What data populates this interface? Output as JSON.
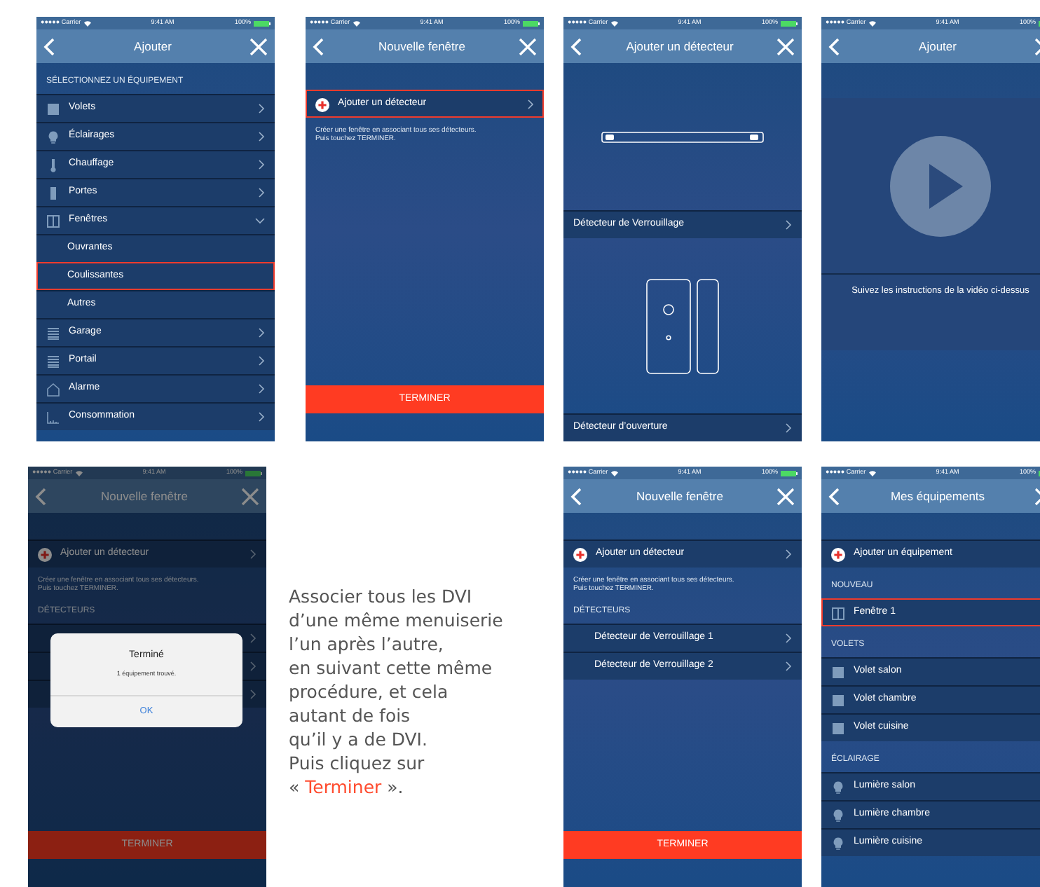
{
  "panels": [
    {
      "kind": "phone",
      "status": {
        "carrier": "●●●●● Carrier",
        "time": "9:41 AM",
        "battery": "100%"
      },
      "title": "Ajouter",
      "dimmed": false,
      "blocks": [
        {
          "kind": "section",
          "label": "SÉLECTIONNEZ UN ÉQUIPEMENT"
        },
        {
          "kind": "shutter",
          "label": "Volets",
          "expanded": false,
          "sub": false,
          "highlighted": false
        },
        {
          "kind": "bulb",
          "label": "Éclairages",
          "expanded": false,
          "sub": false,
          "highlighted": false
        },
        {
          "kind": "thermometer",
          "label": "Chauffage",
          "expanded": false,
          "sub": false,
          "highlighted": false
        },
        {
          "kind": "door",
          "label": "Portes",
          "expanded": false,
          "sub": false,
          "highlighted": false
        },
        {
          "kind": "window",
          "label": "Fenêtres",
          "expanded": true,
          "sub": false,
          "highlighted": false
        },
        {
          "kind": "plain",
          "label": "Ouvrantes",
          "sub": true,
          "highlighted": false
        },
        {
          "kind": "plain",
          "label": "Coulissantes",
          "sub": true,
          "highlighted": true
        },
        {
          "kind": "plain",
          "label": "Autres",
          "sub": true,
          "highlighted": false
        },
        {
          "kind": "lines",
          "label": "Garage",
          "expanded": false,
          "sub": false,
          "highlighted": false
        },
        {
          "kind": "lines",
          "label": "Portail",
          "expanded": false,
          "sub": false,
          "highlighted": false
        },
        {
          "kind": "house",
          "label": "Alarme",
          "expanded": false,
          "sub": false,
          "highlighted": false
        },
        {
          "kind": "chart",
          "label": "Consommation",
          "expanded": false,
          "sub": false,
          "highlighted": false
        }
      ]
    },
    {
      "kind": "phone",
      "status": {
        "carrier": "●●●●● Carrier",
        "time": "9:41 AM",
        "battery": "100%"
      },
      "title": "Nouvelle fenêtre",
      "dimmed": false,
      "blocks": [
        {
          "kind": "add",
          "label": "Ajouter un détecteur",
          "expanded": false,
          "sub": false,
          "highlighted": true
        },
        {
          "kind": "note",
          "text": "Créer une fenêtre en associant tous ses détecteurs.\nPuis touchez TERMINER."
        }
      ],
      "button": "TERMINER"
    },
    {
      "kind": "phone",
      "status": {
        "carrier": "●●●●● Carrier",
        "time": "9:41 AM",
        "battery": "100%"
      },
      "title": "Ajouter un détecteur",
      "dimmed": false,
      "blocks": [
        {
          "kind": "bar-sensor"
        },
        {
          "kind": "plain",
          "label": "Détecteur de Verrouillage",
          "expanded": false,
          "sub": false,
          "highlighted": false
        },
        {
          "kind": "door-sensor"
        },
        {
          "kind": "plain",
          "label": "Détecteur d’ouverture",
          "expanded": false,
          "sub": false,
          "highlighted": false
        }
      ]
    },
    {
      "kind": "phone",
      "status": {
        "carrier": "●●●●● Carrier",
        "time": "9:41 AM",
        "battery": "100%"
      },
      "title": "Ajouter",
      "dimmed": false,
      "blocks": [
        {
          "kind": "video",
          "caption": "Suivez les instructions de la vidéo ci-dessus"
        }
      ]
    },
    {
      "kind": "phone",
      "status": {
        "carrier": "●●●●● Carrier",
        "time": "9:41 AM",
        "battery": "100%"
      },
      "title": "Nouvelle fenêtre",
      "dimmed": true,
      "blocks": [
        {
          "kind": "add",
          "label": "Ajouter un détecteur",
          "expanded": false,
          "sub": false,
          "highlighted": false
        },
        {
          "kind": "note",
          "text": "Créer une fenêtre en associant tous ses détecteurs.\nPuis touchez TERMINER."
        },
        {
          "kind": "section",
          "label": "DÉTECTEURS"
        },
        {
          "kind": "plain",
          "expanded": false,
          "highlighted": false
        },
        {
          "kind": "plain",
          "expanded": false,
          "highlighted": false
        },
        {
          "kind": "plain",
          "expanded": false,
          "highlighted": false
        }
      ],
      "button": "TERMINER",
      "dialog": {
        "title": "Terminé",
        "message": "1 équipement trouvé.",
        "action": "OK"
      }
    },
    {
      "kind": "text",
      "lines": [
        "Associer tous les DVI",
        "d’une même menuiserie",
        "l’un après l’autre,",
        "en suivant cette même",
        "procédure, et cela",
        "autant de fois",
        "qu’il y a de DVI.",
        "Puis cliquez sur"
      ],
      "last_line": {
        "before": "« ",
        "highlight": "Terminer",
        "after": " »."
      }
    },
    {
      "kind": "phone",
      "status": {
        "carrier": "●●●●● Carrier",
        "time": "9:41 AM",
        "battery": "100%"
      },
      "title": "Nouvelle fenêtre",
      "dimmed": false,
      "blocks": [
        {
          "kind": "add",
          "label": "Ajouter un détecteur",
          "expanded": false,
          "sub": false,
          "highlighted": false
        },
        {
          "kind": "note",
          "text": "Créer une fenêtre en associant tous ses détecteurs.\nPuis touchez TERMINER."
        },
        {
          "kind": "section",
          "label": "DÉTECTEURS"
        },
        {
          "kind": "plain",
          "label": "Détecteur de Verrouillage 1",
          "expanded": false,
          "sub": true,
          "highlighted": false
        },
        {
          "kind": "plain",
          "label": "Détecteur de Verrouillage 2",
          "expanded": false,
          "sub": true,
          "highlighted": false
        }
      ],
      "button": "TERMINER"
    },
    {
      "kind": "phone",
      "status": {
        "carrier": "●●●●● Carrier",
        "time": "9:41 AM",
        "battery": "100%"
      },
      "title": "Mes équipements",
      "dimmed": false,
      "blocks": [
        {
          "kind": "add",
          "label": "Ajouter un équipement",
          "sub": false,
          "highlighted": false
        },
        {
          "kind": "section",
          "label": "NOUVEAU"
        },
        {
          "kind": "window",
          "label": "Fenêtre 1",
          "sub": false,
          "highlighted": true
        },
        {
          "kind": "section",
          "label": "VOLETS"
        },
        {
          "kind": "shutter",
          "label": "Volet salon",
          "sub": false,
          "highlighted": false
        },
        {
          "kind": "shutter",
          "label": "Volet chambre",
          "sub": false,
          "highlighted": false
        },
        {
          "kind": "shutter",
          "label": "Volet cuisine",
          "sub": false,
          "highlighted": false
        },
        {
          "kind": "section",
          "label": "ÉCLAIRAGE"
        },
        {
          "kind": "bulb",
          "label": "Lumière salon",
          "sub": false,
          "highlighted": false
        },
        {
          "kind": "bulb",
          "label": "Lumière chambre",
          "sub": false,
          "highlighted": false
        },
        {
          "kind": "bulb",
          "label": "Lumière cuisine",
          "sub": false,
          "highlighted": false
        }
      ]
    }
  ]
}
